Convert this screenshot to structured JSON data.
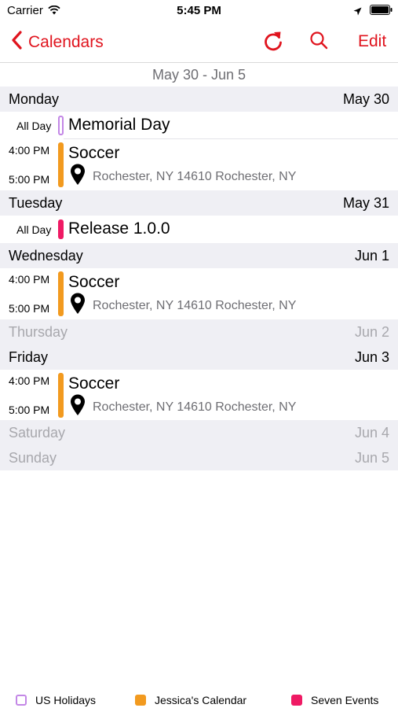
{
  "status_bar": {
    "carrier": "Carrier",
    "time": "5:45 PM"
  },
  "nav": {
    "back_label": "Calendars",
    "edit_label": "Edit"
  },
  "week_range": "May 30 - Jun 5",
  "colors": {
    "accent": "#e0141e",
    "us_holidays": "#c387e6",
    "jessicas_calendar": "#f29a1f",
    "seven_events": "#ef1a64"
  },
  "days": [
    {
      "name": "Monday",
      "date": "May 30"
    },
    {
      "name": "Tuesday",
      "date": "May 31"
    },
    {
      "name": "Wednesday",
      "date": "Jun 1"
    },
    {
      "name": "Thursday",
      "date": "Jun 2"
    },
    {
      "name": "Friday",
      "date": "Jun 3"
    },
    {
      "name": "Saturday",
      "date": "Jun 4"
    },
    {
      "name": "Sunday",
      "date": "Jun 5"
    }
  ],
  "events": [
    {
      "allday_label": "All Day",
      "title": "Memorial Day",
      "calendar": "US Holidays"
    },
    {
      "start": "4:00 PM",
      "end": "5:00 PM",
      "title": "Soccer",
      "location": "Rochester, NY  14610 Rochester, NY",
      "calendar": "Jessica's Calendar"
    },
    {
      "allday_label": "All Day",
      "title": "Release 1.0.0",
      "calendar": "Seven Events"
    },
    {
      "start": "4:00 PM",
      "end": "5:00 PM",
      "title": "Soccer",
      "location": "Rochester, NY  14610 Rochester, NY",
      "calendar": "Jessica's Calendar"
    },
    {
      "start": "4:00 PM",
      "end": "5:00 PM",
      "title": "Soccer",
      "location": "Rochester, NY  14610 Rochester, NY",
      "calendar": "Jessica's Calendar"
    }
  ],
  "legend": [
    {
      "label": "US Holidays",
      "color": "#c387e6",
      "style": "outline"
    },
    {
      "label": "Jessica's Calendar",
      "color": "#f29a1f",
      "style": "filled"
    },
    {
      "label": "Seven Events",
      "color": "#ef1a64",
      "style": "filled"
    }
  ]
}
